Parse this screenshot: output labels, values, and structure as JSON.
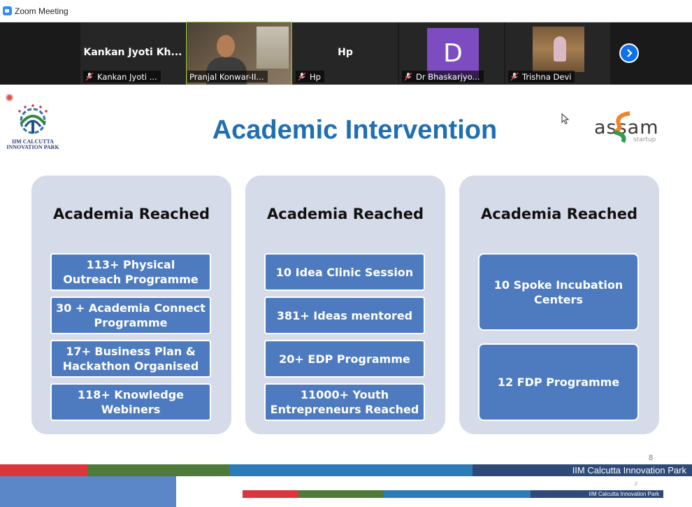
{
  "window": {
    "title": "Zoom Meeting"
  },
  "participants": [
    {
      "display": "Kankan Jyoti Kh...",
      "label": "Kankan Jyoti ...",
      "muted": true
    },
    {
      "display": "",
      "label": "Pranjal Konwar-II...",
      "muted": false,
      "video": true
    },
    {
      "display": "Hp",
      "label": "Hp",
      "muted": true
    },
    {
      "display": "D",
      "label": "Dr Bhaskarjyo...",
      "muted": true,
      "avatar_color": "#7d4cc0"
    },
    {
      "display": "",
      "label": "Trishna Devi",
      "muted": true,
      "photo": true
    }
  ],
  "strip_controls": {
    "next_icon": "chevron-right-icon"
  },
  "slide": {
    "title": "Academic Intervention",
    "left_logo": {
      "name": "IIM Calcutta Innovation Park logo",
      "text_line1": "IIM CALCUTTA",
      "text_line2": "INNOVATION PARK"
    },
    "right_logo": {
      "name": "Assam Startup logo",
      "text": "assam",
      "sub": "startup"
    },
    "panels": [
      {
        "title": "Academia Reached",
        "cards": [
          "113+ Physical Outreach Programme",
          "30 + Academia Connect Programme",
          "17+ Business Plan & Hackathon Organised",
          "118+ Knowledge Webiners"
        ]
      },
      {
        "title": "Academia Reached",
        "cards": [
          "10 Idea Clinic Session",
          "381+ Ideas mentored",
          "20+ EDP Programme",
          "11000+ Youth Entrepreneurs Reached"
        ]
      },
      {
        "title": "Academia Reached",
        "cards": [
          "10 Spoke Incubation Centers",
          "12 FDP Programme"
        ]
      }
    ],
    "page_number": "8",
    "footer": "IIM Calcutta Innovation Park",
    "mini_page_number": "2",
    "mini_footer": "IIM Calcutta Innovation Park"
  },
  "colors": {
    "title_blue": "#1f6fb2",
    "card_blue": "#4e7bbf",
    "panel_bg": "#d6dbe9",
    "footer_navy": "#2e4a78"
  }
}
